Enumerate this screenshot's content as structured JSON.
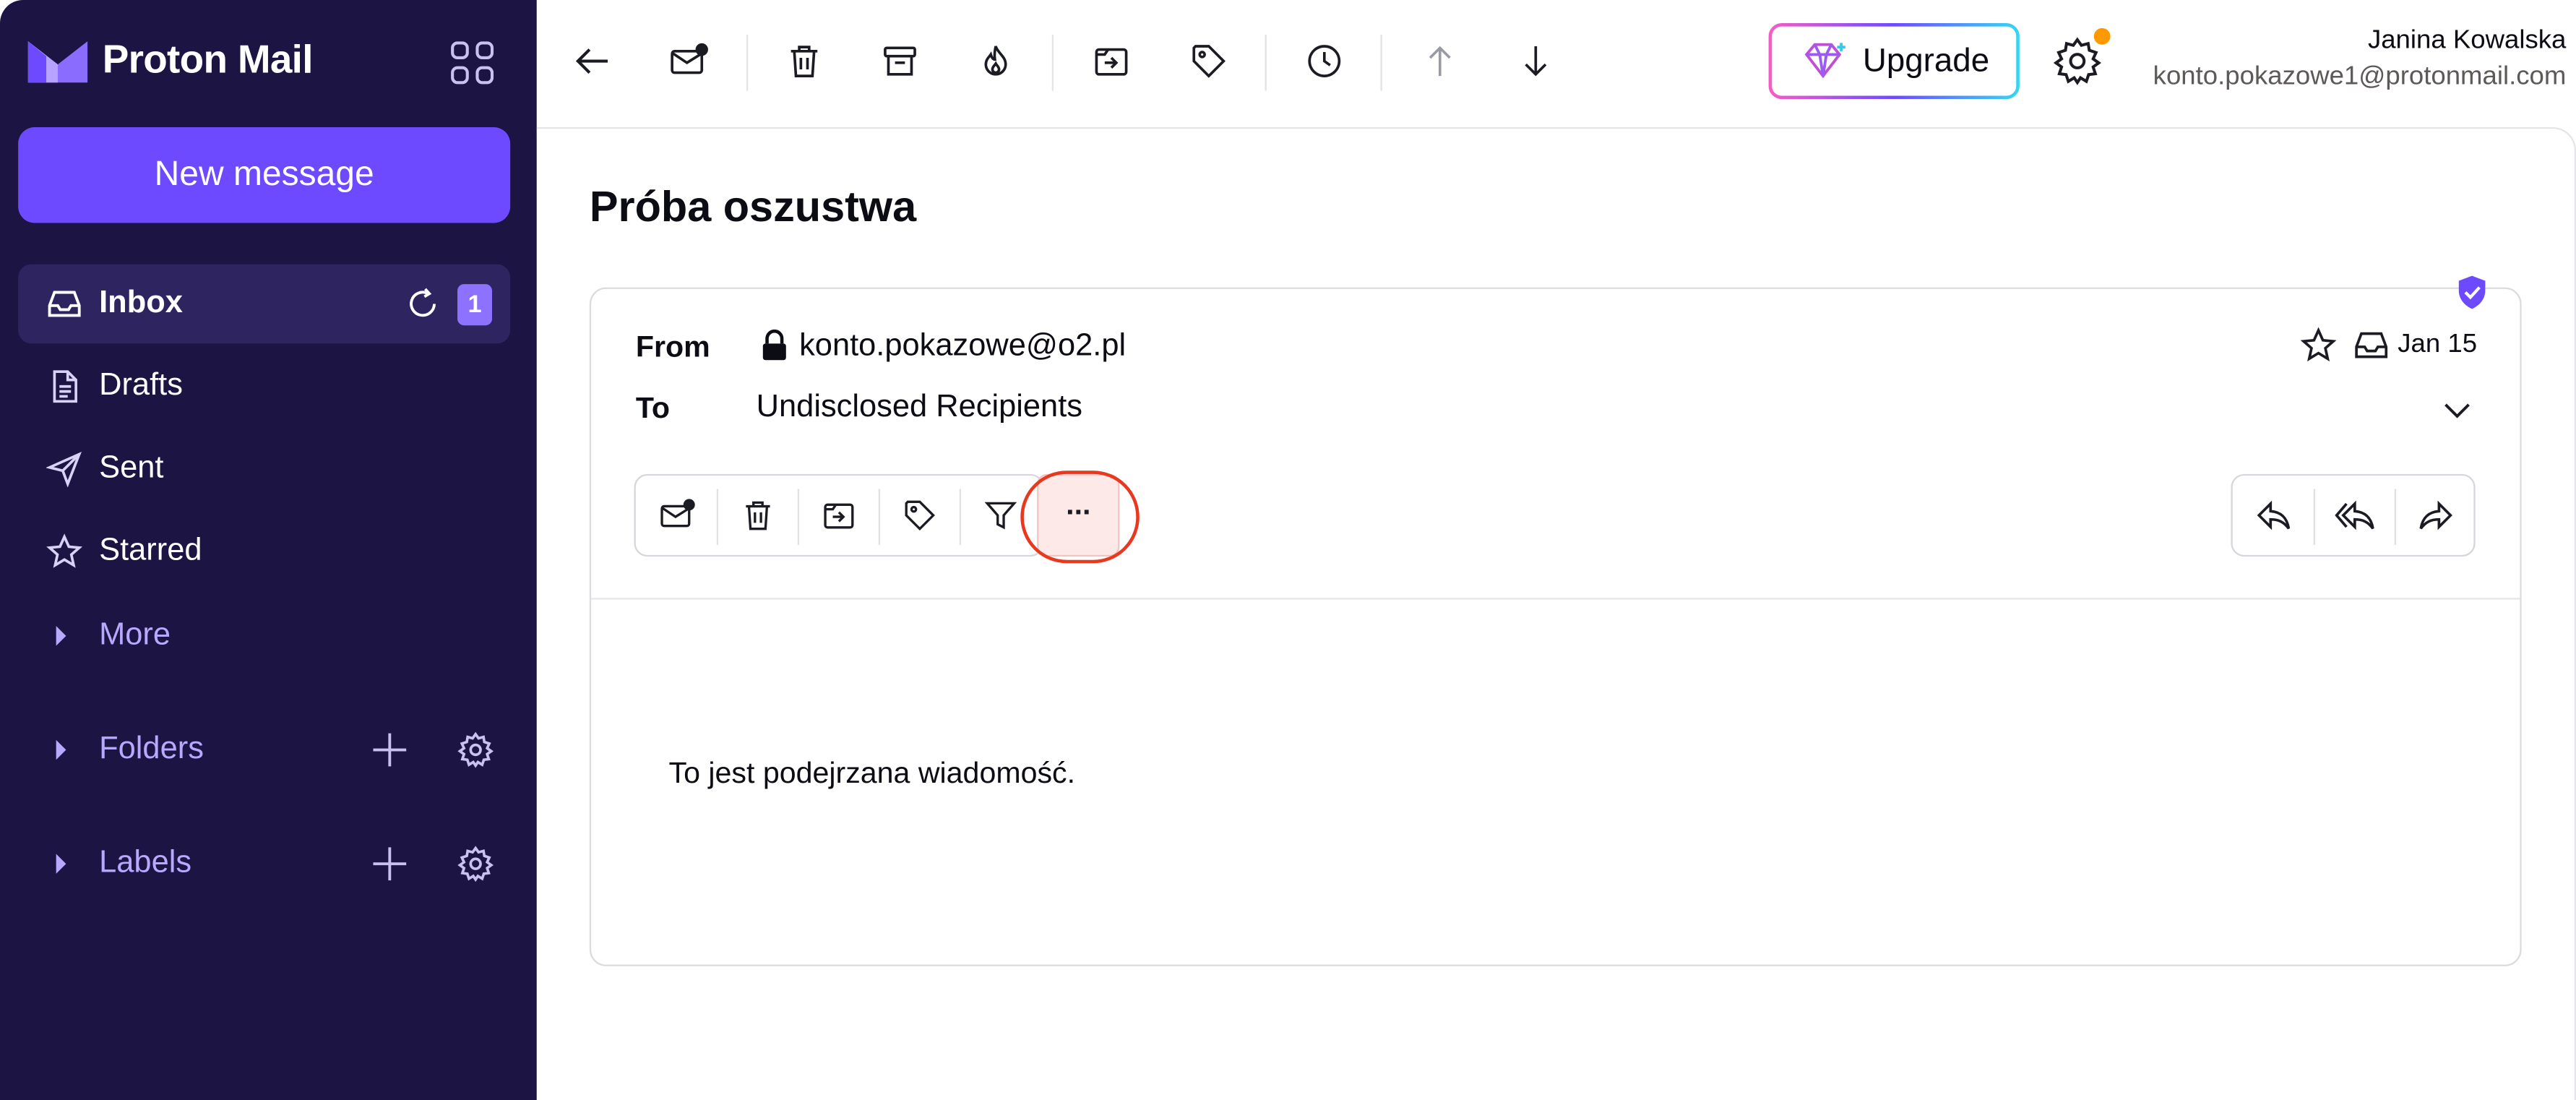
{
  "brand": {
    "name": "Proton Mail"
  },
  "sidebar": {
    "new_message_label": "New message",
    "items": [
      {
        "label": "Inbox",
        "icon": "inbox-icon",
        "badge": "1",
        "active": true
      },
      {
        "label": "Drafts",
        "icon": "file-icon"
      },
      {
        "label": "Sent",
        "icon": "paper-plane-icon"
      },
      {
        "label": "Starred",
        "icon": "star-icon"
      },
      {
        "label": "More",
        "icon": "caret-right-icon"
      }
    ],
    "folders_label": "Folders",
    "labels_label": "Labels"
  },
  "toolbar": {
    "buttons": [
      "back-arrow-icon",
      "mark-unread-icon",
      "trash-icon",
      "archive-icon",
      "spam-fire-icon",
      "move-to-folder-icon",
      "label-tag-icon",
      "snooze-clock-icon",
      "previous-arrow-up-icon",
      "next-arrow-down-icon"
    ],
    "upgrade_label": "Upgrade"
  },
  "user": {
    "name": "Janina Kowalska",
    "email": "konto.pokazowe1@protonmail.com"
  },
  "message": {
    "subject": "Próba oszustwa",
    "from_label": "From",
    "from_value": "konto.pokazowe@o2.pl",
    "to_label": "To",
    "to_value": "Undisclosed Recipients",
    "date": "Jan 15",
    "more_label": "···",
    "body": "To jest podejrzana wiadomość."
  },
  "colors": {
    "sidebar_bg": "#1c1443",
    "accent": "#6d4aff",
    "highlight_ring": "#e8391f",
    "notification_dot": "#ff9900"
  }
}
